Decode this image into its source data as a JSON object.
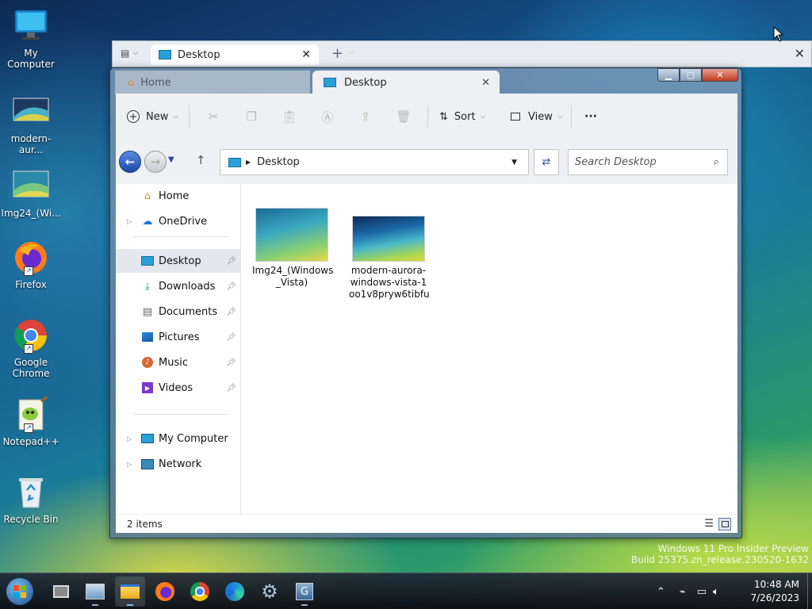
{
  "desktop": {
    "icons": [
      {
        "label": "My Computer"
      },
      {
        "label": "modern-aur..."
      },
      {
        "label": "Img24_(Wi..."
      },
      {
        "label": "Firefox"
      },
      {
        "label": "Google Chrome"
      },
      {
        "label": "Notepad++"
      },
      {
        "label": "Recycle Bin"
      }
    ]
  },
  "outer_window": {
    "tab_label": "Desktop",
    "new_tab_label": "+"
  },
  "explorer": {
    "tabs": [
      {
        "label": "Home"
      },
      {
        "label": "Desktop"
      }
    ],
    "toolbar": {
      "new_label": "New",
      "sort_label": "Sort",
      "view_label": "View",
      "more_label": "···"
    },
    "address": {
      "path": "Desktop",
      "search_placeholder": "Search Desktop"
    },
    "nav": {
      "home": "Home",
      "onedrive": "OneDrive",
      "desktop": "Desktop",
      "downloads": "Downloads",
      "documents": "Documents",
      "pictures": "Pictures",
      "music": "Music",
      "videos": "Videos",
      "my_computer": "My Computer",
      "network": "Network"
    },
    "files": [
      {
        "name_line1": "Img24_(Windows",
        "name_line2": "_Vista)",
        "name_line3": ""
      },
      {
        "name_line1": "modern-aurora-",
        "name_line2": "windows-vista-1",
        "name_line3": "oo1v8pryw6tibfu"
      }
    ],
    "status": {
      "item_count": "2 items"
    }
  },
  "watermark": {
    "line1": "Windows 11 Pro Insider Preview",
    "line2": "Build 25375.zn_release.230520-1632"
  },
  "taskbar": {
    "time": "10:48 AM",
    "date": "7/26/2023"
  }
}
